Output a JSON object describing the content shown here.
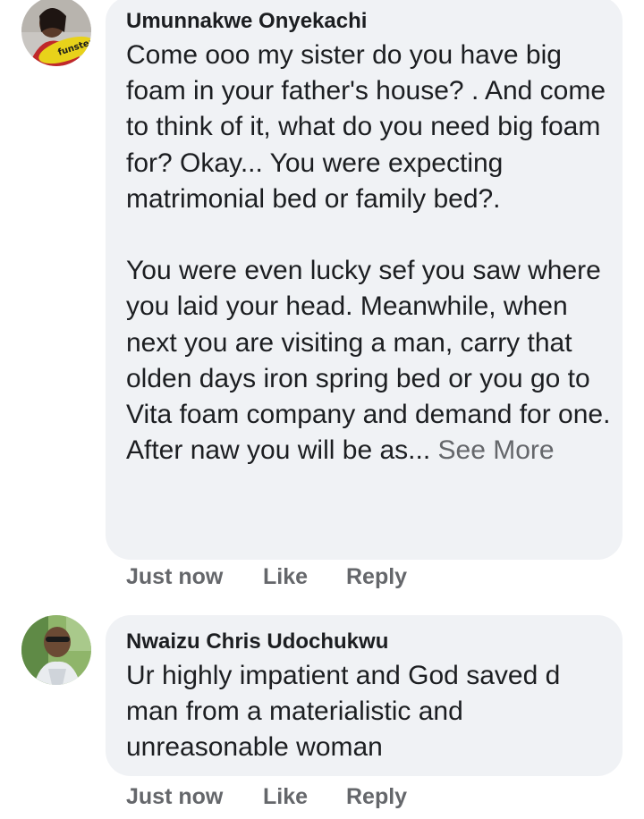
{
  "comments": [
    {
      "author": "Umunnakwe Onyekachi",
      "avatar_label": "funster",
      "text": "Come ooo my sister do you have big foam in your father's house? . And come to think of it, what do you need big foam for?  Okay... You were expecting  matrimonial bed or family bed?.\n\nYou were even lucky sef you saw where you laid your head. Meanwhile, when next you are visiting a man, carry that olden days iron spring bed or you go to Vita foam company and demand for one.\nAfter naw you will be as...",
      "see_more": "See More",
      "time": "Just now",
      "like": "Like",
      "reply": "Reply"
    },
    {
      "author": "Nwaizu Chris Udochukwu",
      "text": "Ur highly impatient and God saved d man from a materialistic and unreasonable woman",
      "time": "Just now",
      "like": "Like",
      "reply": "Reply"
    }
  ],
  "colors": {
    "bubble": "#f0f2f5",
    "secondary_text": "#65676b",
    "primary_text": "#1c1e21"
  }
}
